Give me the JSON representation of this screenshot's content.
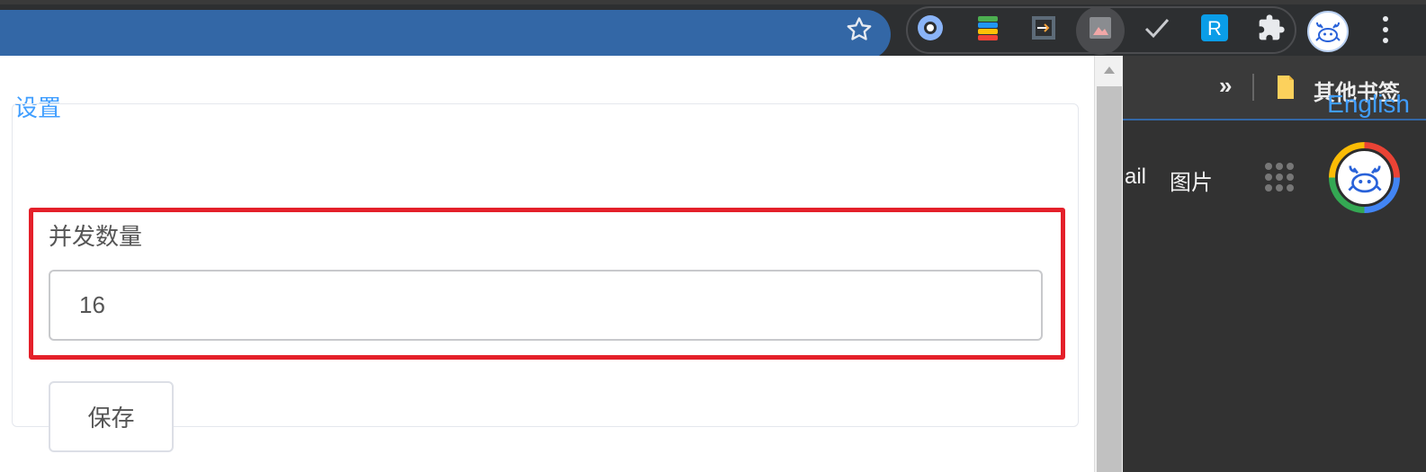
{
  "popup": {
    "title": "设置",
    "language_link": "English",
    "concurrency": {
      "label": "并发数量",
      "value": "16"
    },
    "save_label": "保存"
  },
  "bookmarks_bar": {
    "overflow": "»",
    "other_bookmarks": "其他书签"
  },
  "page": {
    "gmail_partial": "ail",
    "images_link": "图片"
  },
  "colors": {
    "accent": "#409eff",
    "highlight": "#e4202a",
    "omnibox": "#3367a6"
  },
  "extensions": [
    "circle-extension-icon",
    "stacked-colors-extension-icon",
    "window-arrow-extension-icon",
    "image-extension-icon",
    "check-extension-icon",
    "r-extension-icon",
    "puzzle-extensions-icon"
  ]
}
